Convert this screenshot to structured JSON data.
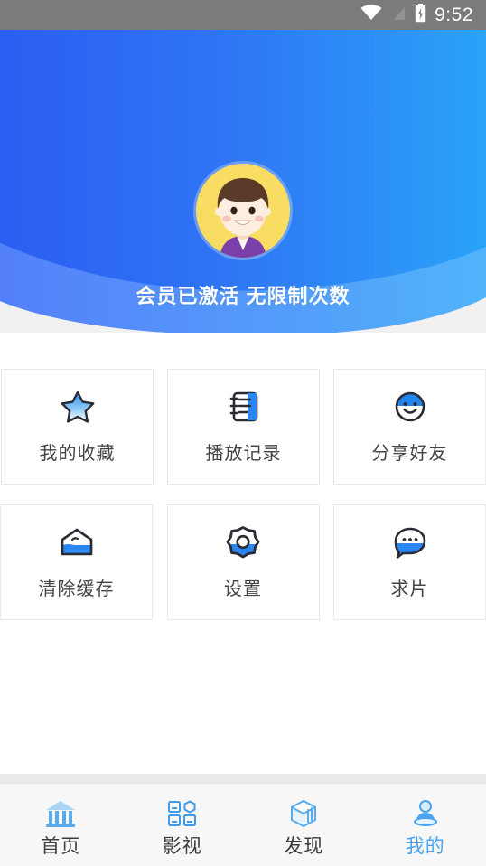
{
  "statusbar": {
    "time": "9:52",
    "icons": [
      "wifi-icon",
      "signal-off-icon",
      "battery-charging-icon"
    ]
  },
  "header": {
    "avatar_name": "user-avatar",
    "member_text": "会员已激活 无限制次数",
    "gradient_start": "#2b62f2",
    "gradient_end": "#2aa0f7",
    "wave_overlay": "#5b8dfb"
  },
  "grid": {
    "tiles": [
      {
        "label": "我的收藏",
        "icon": "star-icon"
      },
      {
        "label": "播放记录",
        "icon": "notebook-icon"
      },
      {
        "label": "分享好友",
        "icon": "smiley-icon"
      },
      {
        "label": "清除缓存",
        "icon": "cache-house-icon"
      },
      {
        "label": "设置",
        "icon": "gear-icon"
      },
      {
        "label": "求片",
        "icon": "chat-bubble-icon"
      }
    ]
  },
  "navbar": {
    "active_color": "#4aa3ef",
    "items": [
      {
        "label": "首页",
        "icon": "bank-building-icon",
        "active": false
      },
      {
        "label": "影视",
        "icon": "grid-apps-icon",
        "active": false
      },
      {
        "label": "发现",
        "icon": "cube-icon",
        "active": false
      },
      {
        "label": "我的",
        "icon": "person-icon",
        "active": true
      }
    ]
  }
}
